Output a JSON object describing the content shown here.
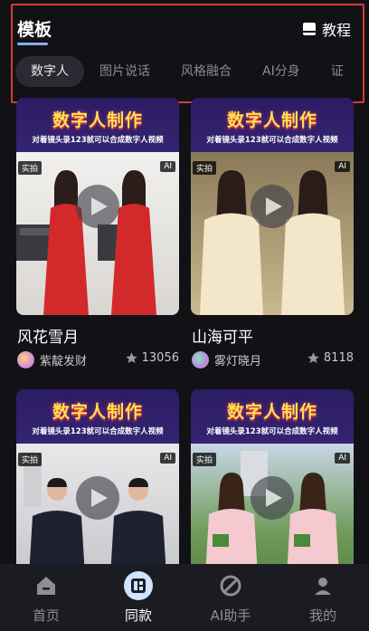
{
  "header": {
    "title": "模板",
    "tutorial_label": "教程"
  },
  "tabs": [
    {
      "label": "数字人"
    },
    {
      "label": "图片说话"
    },
    {
      "label": "风格融合"
    },
    {
      "label": "AI分身"
    },
    {
      "label": "证"
    }
  ],
  "cards": [
    {
      "banner_title": "数字人制作",
      "banner_sub": "对着镜头录123就可以合成数字人视频",
      "tag_left": "实拍",
      "tag_right": "AI",
      "title": "风花雪月",
      "author": "紫靛发财",
      "likes": "13056"
    },
    {
      "banner_title": "数字人制作",
      "banner_sub": "对着镜头录123就可以合成数字人视频",
      "tag_left": "实拍",
      "tag_right": "AI",
      "title": "山海可平",
      "author": "雾灯晓月",
      "likes": "8118"
    },
    {
      "banner_title": "数字人制作",
      "banner_sub": "对着镜头录123就可以合成数字人视频",
      "tag_left": "实拍",
      "tag_right": "AI"
    },
    {
      "banner_title": "数字人制作",
      "banner_sub": "对着镜头录123就可以合成数字人视频",
      "tag_left": "实拍",
      "tag_right": "AI"
    }
  ],
  "nav": [
    {
      "label": "首页"
    },
    {
      "label": "同款"
    },
    {
      "label": "AI助手"
    },
    {
      "label": "我的"
    }
  ],
  "colors": {
    "background": "#111116",
    "highlight_box": "#d93a34",
    "active_tab_bg": "#2a2a33",
    "active_nav_bg": "#cfe3ff"
  }
}
